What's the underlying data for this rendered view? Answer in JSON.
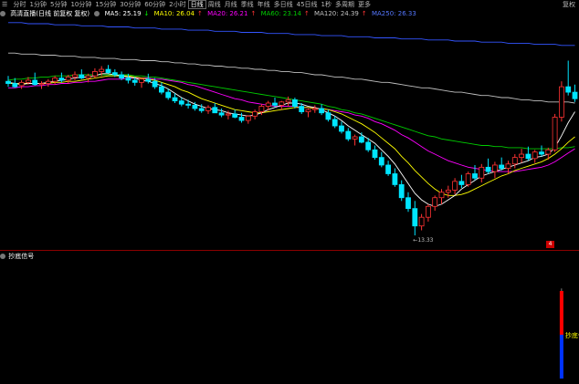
{
  "toolbar": {
    "items": [
      "分时",
      "1分钟",
      "5分钟",
      "10分钟",
      "15分钟",
      "30分钟",
      "60分钟",
      "2小时",
      "日线",
      "周线",
      "月线",
      "季线",
      "年线",
      "多日线",
      "45日线",
      "1秒",
      "多周期",
      "更多"
    ],
    "active_index": 8,
    "right_label": "复权",
    "menu_icon": "menu-icon"
  },
  "ma_bar": {
    "title": "高清直播(日线 前复权 复权)",
    "info_icon": "circle-icon",
    "ma5": "MA5: 25.19",
    "ma10": "MA10: 26.04",
    "ma20": "MA20: 26.21",
    "ma60": "MA60: 23.14",
    "ma120": "MA120: 24.39",
    "ma250": "MA250: 26.33",
    "arrow_down": "↓",
    "arrow_up": "↑"
  },
  "colors": {
    "ma5": "#ffffff",
    "ma10": "#ffff00",
    "ma20": "#ff00ff",
    "ma60": "#00cc00",
    "ma120": "#c0c0c0",
    "ma250": "#3355ff",
    "up": "#ff3333",
    "down": "#00e5ff"
  },
  "chart": {
    "low_marker": "←13.33",
    "right_marker": "4"
  },
  "sub_chart": {
    "title": "抄底信号",
    "signal_label": "抄底信号",
    "settings_icon": "circle-icon"
  },
  "chart_data": {
    "type": "candlestick",
    "candles": [
      [
        27.5,
        28.0,
        27.0,
        27.3
      ],
      [
        27.3,
        27.8,
        26.9,
        27.0
      ],
      [
        27.1,
        27.6,
        26.8,
        27.4
      ],
      [
        27.4,
        27.9,
        27.2,
        27.6
      ],
      [
        27.6,
        28.3,
        27.1,
        27.2
      ],
      [
        27.2,
        27.5,
        26.8,
        27.3
      ],
      [
        27.3,
        27.7,
        27.0,
        27.5
      ],
      [
        27.5,
        28.0,
        27.2,
        27.8
      ],
      [
        27.8,
        28.3,
        27.4,
        27.6
      ],
      [
        27.6,
        28.1,
        27.3,
        27.9
      ],
      [
        27.9,
        28.4,
        27.6,
        28.1
      ],
      [
        28.1,
        28.6,
        27.7,
        27.8
      ],
      [
        27.8,
        28.2,
        27.4,
        28.0
      ],
      [
        28.0,
        28.7,
        27.8,
        28.4
      ],
      [
        28.4,
        28.9,
        28.0,
        28.6
      ],
      [
        28.6,
        29.0,
        28.2,
        28.3
      ],
      [
        28.3,
        28.6,
        27.9,
        28.1
      ],
      [
        28.1,
        28.4,
        27.6,
        27.8
      ],
      [
        27.8,
        28.2,
        27.3,
        27.6
      ],
      [
        27.6,
        27.9,
        27.1,
        27.4
      ],
      [
        27.4,
        27.8,
        26.9,
        27.7
      ],
      [
        27.7,
        28.2,
        27.3,
        27.5
      ],
      [
        27.5,
        27.8,
        26.8,
        27.0
      ],
      [
        27.0,
        27.4,
        26.3,
        26.5
      ],
      [
        26.5,
        26.8,
        25.8,
        26.0
      ],
      [
        26.0,
        26.4,
        25.5,
        25.7
      ],
      [
        25.7,
        26.0,
        25.2,
        25.4
      ],
      [
        25.4,
        25.8,
        25.0,
        25.3
      ],
      [
        25.3,
        25.6,
        24.8,
        25.0
      ],
      [
        25.0,
        25.4,
        24.6,
        24.8
      ],
      [
        24.8,
        25.3,
        24.5,
        25.1
      ],
      [
        25.1,
        25.5,
        24.7,
        24.6
      ],
      [
        24.6,
        25.0,
        24.2,
        24.4
      ],
      [
        24.4,
        24.8,
        24.0,
        24.5
      ],
      [
        24.5,
        24.9,
        24.1,
        24.2
      ],
      [
        24.2,
        24.6,
        23.7,
        23.9
      ],
      [
        23.9,
        24.4,
        23.6,
        24.3
      ],
      [
        24.3,
        24.9,
        24.0,
        24.7
      ],
      [
        24.7,
        25.4,
        24.4,
        25.2
      ],
      [
        25.2,
        25.7,
        24.8,
        25.5
      ],
      [
        25.5,
        26.0,
        25.1,
        25.3
      ],
      [
        25.3,
        25.7,
        24.9,
        25.6
      ],
      [
        25.6,
        26.1,
        25.2,
        25.8
      ],
      [
        25.8,
        26.0,
        25.0,
        25.2
      ],
      [
        25.2,
        25.5,
        24.5,
        24.7
      ],
      [
        24.7,
        25.0,
        24.2,
        24.9
      ],
      [
        24.9,
        25.3,
        24.6,
        25.0
      ],
      [
        25.0,
        25.4,
        24.4,
        24.6
      ],
      [
        24.6,
        24.9,
        23.8,
        24.0
      ],
      [
        24.0,
        24.3,
        23.2,
        23.4
      ],
      [
        23.4,
        23.8,
        22.7,
        22.9
      ],
      [
        22.9,
        23.2,
        22.0,
        22.2
      ],
      [
        22.2,
        22.6,
        21.6,
        22.4
      ],
      [
        22.4,
        22.8,
        21.8,
        21.9
      ],
      [
        21.9,
        22.3,
        21.0,
        21.2
      ],
      [
        21.2,
        21.6,
        20.3,
        20.5
      ],
      [
        20.5,
        21.0,
        19.6,
        19.8
      ],
      [
        19.8,
        20.2,
        18.8,
        19.0
      ],
      [
        19.0,
        19.5,
        17.8,
        18.0
      ],
      [
        18.0,
        18.4,
        16.5,
        16.8
      ],
      [
        16.8,
        17.3,
        15.5,
        15.8
      ],
      [
        15.8,
        16.5,
        13.33,
        14.2
      ],
      [
        14.2,
        15.3,
        13.8,
        15.0
      ],
      [
        15.0,
        16.2,
        14.6,
        16.0
      ],
      [
        16.0,
        17.0,
        15.6,
        16.8
      ],
      [
        16.8,
        17.6,
        16.2,
        17.3
      ],
      [
        17.3,
        17.9,
        16.8,
        17.5
      ],
      [
        17.5,
        18.6,
        17.1,
        18.3
      ],
      [
        18.3,
        18.9,
        17.7,
        18.0
      ],
      [
        18.0,
        19.2,
        17.8,
        19.0
      ],
      [
        19.0,
        19.8,
        18.4,
        18.6
      ],
      [
        18.6,
        19.9,
        18.2,
        19.6
      ],
      [
        19.6,
        20.4,
        19.0,
        19.2
      ],
      [
        19.2,
        20.1,
        18.6,
        19.8
      ],
      [
        19.8,
        20.5,
        19.3,
        19.5
      ],
      [
        19.5,
        20.2,
        19.0,
        19.9
      ],
      [
        19.9,
        20.8,
        19.5,
        20.5
      ],
      [
        20.5,
        21.3,
        20.0,
        20.8
      ],
      [
        20.8,
        21.5,
        20.2,
        20.4
      ],
      [
        20.4,
        21.2,
        20.0,
        21.0
      ],
      [
        21.0,
        21.6,
        20.6,
        20.8
      ],
      [
        20.8,
        21.4,
        20.3,
        21.2
      ],
      [
        21.2,
        24.5,
        21.0,
        24.2
      ],
      [
        24.2,
        27.5,
        23.8,
        27.0
      ],
      [
        27.0,
        29.4,
        26.2,
        26.5
      ],
      [
        26.5,
        27.2,
        25.6,
        25.9
      ]
    ],
    "ma5": [
      27.4,
      27.3,
      27.2,
      27.3,
      27.3,
      27.3,
      27.4,
      27.5,
      27.6,
      27.7,
      27.8,
      27.9,
      27.9,
      28.0,
      28.2,
      28.2,
      28.1,
      28.0,
      27.9,
      27.8,
      27.6,
      27.5,
      27.3,
      27.1,
      26.8,
      26.4,
      26.0,
      25.7,
      25.4,
      25.2,
      25.0,
      24.9,
      24.8,
      24.6,
      24.5,
      24.4,
      24.3,
      24.4,
      24.6,
      24.9,
      25.1,
      25.3,
      25.5,
      25.5,
      25.4,
      25.2,
      25.1,
      24.9,
      24.6,
      24.3,
      23.9,
      23.4,
      23.0,
      22.6,
      22.2,
      21.8,
      21.2,
      20.6,
      19.9,
      19.0,
      18.1,
      17.2,
      16.6,
      16.2,
      16.0,
      16.2,
      16.6,
      17.0,
      17.6,
      18.0,
      18.4,
      18.8,
      19.0,
      19.2,
      19.4,
      19.6,
      19.8,
      20.0,
      20.2,
      20.5,
      20.6,
      20.8,
      21.4,
      22.5,
      23.7,
      24.7
    ],
    "ma10": [
      27.3,
      27.3,
      27.3,
      27.3,
      27.3,
      27.3,
      27.3,
      27.4,
      27.4,
      27.5,
      27.5,
      27.6,
      27.7,
      27.8,
      27.9,
      28.0,
      28.0,
      28.0,
      28.0,
      27.9,
      27.8,
      27.7,
      27.6,
      27.4,
      27.2,
      27.0,
      26.7,
      26.5,
      26.2,
      25.9,
      25.7,
      25.5,
      25.3,
      25.1,
      24.9,
      24.8,
      24.7,
      24.6,
      24.6,
      24.7,
      24.8,
      24.9,
      25.0,
      25.1,
      25.1,
      25.1,
      25.0,
      25.0,
      24.9,
      24.7,
      24.5,
      24.2,
      23.9,
      23.6,
      23.2,
      22.8,
      22.3,
      21.8,
      21.3,
      20.6,
      20.0,
      19.3,
      18.7,
      18.1,
      17.6,
      17.2,
      17.0,
      17.0,
      17.1,
      17.3,
      17.6,
      17.9,
      18.2,
      18.5,
      18.8,
      19.0,
      19.3,
      19.5,
      19.7,
      19.9,
      20.1,
      20.4,
      20.8,
      21.3,
      21.9,
      22.4
    ],
    "ma20": [
      26.9,
      26.9,
      27.0,
      27.0,
      27.1,
      27.1,
      27.2,
      27.2,
      27.3,
      27.3,
      27.4,
      27.4,
      27.5,
      27.5,
      27.6,
      27.7,
      27.7,
      27.7,
      27.8,
      27.8,
      27.8,
      27.8,
      27.7,
      27.7,
      27.6,
      27.5,
      27.4,
      27.2,
      27.1,
      26.9,
      26.7,
      26.5,
      26.3,
      26.1,
      25.9,
      25.8,
      25.6,
      25.5,
      25.4,
      25.3,
      25.2,
      25.2,
      25.2,
      25.2,
      25.1,
      25.1,
      25.0,
      25.0,
      24.9,
      24.8,
      24.7,
      24.6,
      24.4,
      24.3,
      24.1,
      23.8,
      23.6,
      23.3,
      23.0,
      22.6,
      22.3,
      21.9,
      21.5,
      21.1,
      20.8,
      20.5,
      20.2,
      20.0,
      19.8,
      19.6,
      19.5,
      19.4,
      19.3,
      19.2,
      19.2,
      19.2,
      19.2,
      19.3,
      19.4,
      19.5,
      19.6,
      19.8,
      20.1,
      20.5,
      20.9,
      21.3
    ],
    "ma60": [
      27.6,
      27.7,
      27.7,
      27.8,
      27.8,
      27.9,
      27.9,
      28.0,
      28.0,
      28.0,
      28.1,
      28.1,
      28.1,
      28.1,
      28.1,
      28.1,
      28.1,
      28.1,
      28.1,
      28.0,
      28.0,
      27.9,
      27.9,
      27.8,
      27.7,
      27.6,
      27.5,
      27.4,
      27.3,
      27.2,
      27.1,
      27.0,
      26.9,
      26.8,
      26.7,
      26.6,
      26.5,
      26.4,
      26.3,
      26.2,
      26.1,
      26.0,
      25.9,
      25.8,
      25.7,
      25.6,
      25.5,
      25.4,
      25.2,
      25.1,
      24.9,
      24.8,
      24.6,
      24.5,
      24.3,
      24.1,
      23.9,
      23.7,
      23.5,
      23.3,
      23.1,
      22.9,
      22.7,
      22.5,
      22.4,
      22.2,
      22.1,
      22.0,
      21.9,
      21.8,
      21.7,
      21.6,
      21.6,
      21.5,
      21.5,
      21.4,
      21.4,
      21.4,
      21.3,
      21.3,
      21.3,
      21.3,
      21.3,
      21.4,
      21.4,
      21.5
    ],
    "ma120": [
      30.1,
      30.1,
      30.0,
      30.0,
      30.0,
      29.9,
      29.9,
      29.9,
      29.8,
      29.8,
      29.8,
      29.7,
      29.7,
      29.7,
      29.6,
      29.6,
      29.6,
      29.5,
      29.5,
      29.5,
      29.4,
      29.4,
      29.4,
      29.3,
      29.3,
      29.2,
      29.2,
      29.1,
      29.1,
      29.0,
      29.0,
      28.9,
      28.9,
      28.8,
      28.8,
      28.7,
      28.7,
      28.6,
      28.6,
      28.5,
      28.5,
      28.4,
      28.4,
      28.3,
      28.3,
      28.2,
      28.1,
      28.1,
      28.0,
      27.9,
      27.9,
      27.8,
      27.7,
      27.7,
      27.6,
      27.5,
      27.4,
      27.4,
      27.3,
      27.2,
      27.1,
      27.0,
      26.9,
      26.9,
      26.8,
      26.7,
      26.6,
      26.5,
      26.5,
      26.4,
      26.3,
      26.2,
      26.2,
      26.1,
      26.0,
      26.0,
      25.9,
      25.8,
      25.8,
      25.7,
      25.7,
      25.6,
      25.6,
      25.6,
      25.6,
      25.5
    ],
    "ma250": [
      32.9,
      32.9,
      32.9,
      32.8,
      32.8,
      32.8,
      32.8,
      32.7,
      32.7,
      32.7,
      32.7,
      32.6,
      32.6,
      32.6,
      32.6,
      32.5,
      32.5,
      32.5,
      32.5,
      32.4,
      32.4,
      32.4,
      32.4,
      32.3,
      32.3,
      32.3,
      32.3,
      32.2,
      32.2,
      32.2,
      32.2,
      32.1,
      32.1,
      32.1,
      32.1,
      32.0,
      32.0,
      32.0,
      32.0,
      31.9,
      31.9,
      31.9,
      31.9,
      31.8,
      31.8,
      31.8,
      31.8,
      31.7,
      31.7,
      31.7,
      31.7,
      31.6,
      31.6,
      31.6,
      31.6,
      31.5,
      31.5,
      31.5,
      31.5,
      31.4,
      31.4,
      31.4,
      31.4,
      31.3,
      31.3,
      31.3,
      31.3,
      31.2,
      31.2,
      31.2,
      31.2,
      31.1,
      31.1,
      31.1,
      31.1,
      31.0,
      31.0,
      31.0,
      31.0,
      30.9,
      30.9,
      30.9,
      30.9,
      30.8,
      30.8,
      30.8
    ],
    "ylim": [
      12.5,
      33.3
    ],
    "signal": {
      "index": 83,
      "red_value": 1.0,
      "blue_value": 1.0,
      "line_top": 1.6
    }
  }
}
